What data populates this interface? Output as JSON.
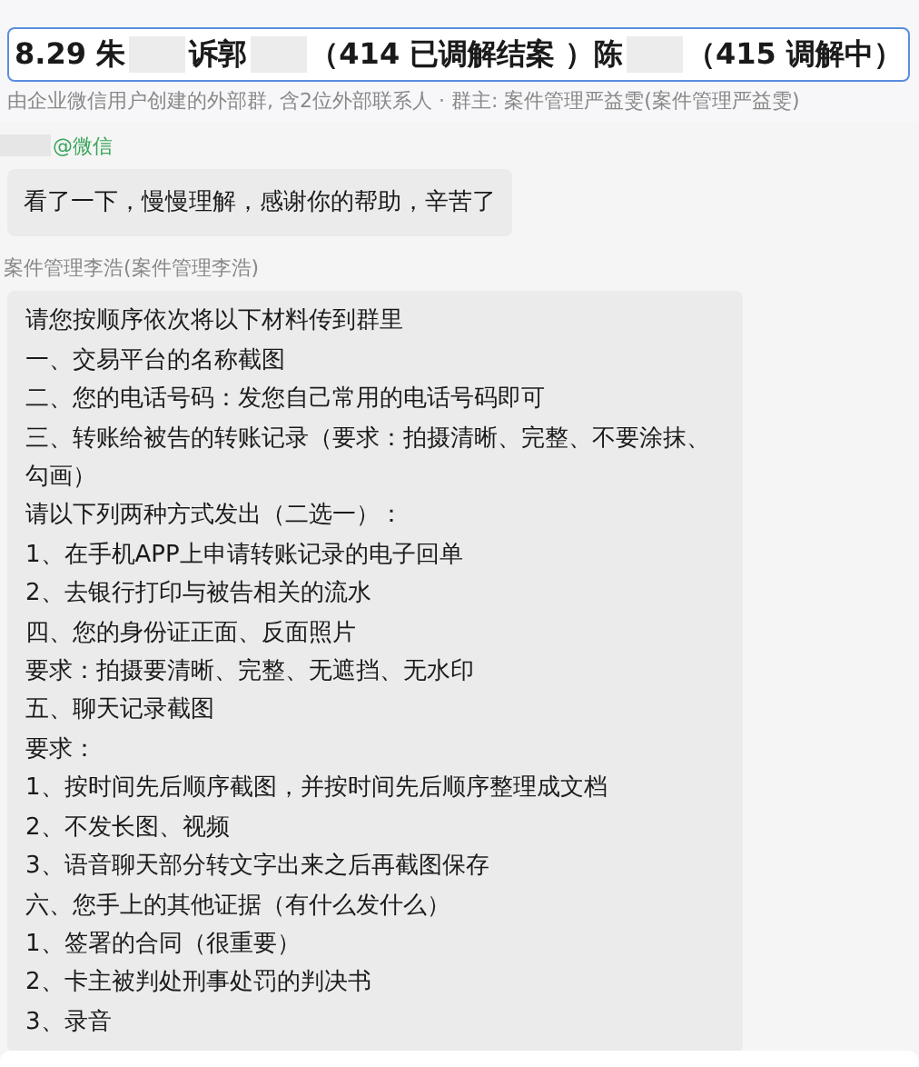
{
  "header": {
    "title": [
      {
        "kind": "text",
        "text": "8.29 朱"
      },
      {
        "kind": "redacted"
      },
      {
        "kind": "text",
        "text": "诉郭"
      },
      {
        "kind": "redacted"
      },
      {
        "kind": "text",
        "text": "（414  已调解结案 ）陈"
      },
      {
        "kind": "redacted"
      },
      {
        "kind": "text",
        "text": "（415 调解中）"
      }
    ],
    "subtitle": "由企业微信用户创建的外部群, 含2位外部联系人 · 群主: 案件管理严益雯(案件管理严益雯)"
  },
  "messages": [
    {
      "sender_redacted": true,
      "sender_tag": "@微信",
      "lines": [
        "看了一下，慢慢理解，感谢你的帮助，辛苦了"
      ]
    },
    {
      "sender": "案件管理李浩(案件管理李浩)",
      "lines": [
        "请您按顺序依次将以下材料传到群里",
        "一、交易平台的名称截图",
        "二、您的电话号码：发您自己常用的电话号码即可",
        "三、转账给被告的转账记录（要求：拍摄清晰、完整、不要涂抹、勾画）",
        "请以下列两种方式发出（二选一）：",
        "1、在手机APP上申请转账记录的电子回单",
        "2、去银行打印与被告相关的流水",
        "四、您的身份证正面、反面照片",
        "要求：拍摄要清晰、完整、无遮挡、无水印",
        "五、聊天记录截图",
        "要求：",
        "1、按时间先后顺序截图，并按时间先后顺序整理成文档",
        "2、不发长图、视频",
        "3、语音聊天部分转文字出来之后再截图保存",
        "六、您手上的其他证据（有什么发什么）",
        "1、签署的合同（很重要）",
        "2、卡主被判处刑事处罚的判决书",
        "3、录音"
      ]
    }
  ]
}
